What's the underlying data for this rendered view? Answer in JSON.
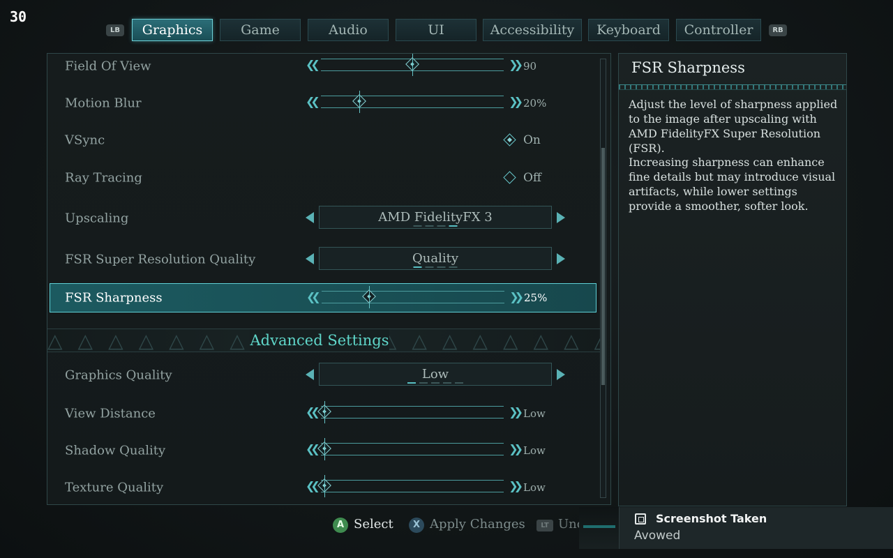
{
  "fps_counter": "30",
  "tabs": {
    "left_bumper": "LB",
    "right_bumper": "RB",
    "items": [
      {
        "label": "Graphics",
        "active": true
      },
      {
        "label": "Game"
      },
      {
        "label": "Audio"
      },
      {
        "label": "UI"
      },
      {
        "label": "Accessibility"
      },
      {
        "label": "Keyboard"
      },
      {
        "label": "Controller"
      }
    ]
  },
  "settings": {
    "field_of_view": {
      "label": "Field Of View",
      "value": "90",
      "level": 0.5
    },
    "motion_blur": {
      "label": "Motion Blur",
      "value": "20%",
      "level": 0.2
    },
    "vsync": {
      "label": "VSync",
      "value": "On",
      "enabled": true
    },
    "ray_tracing": {
      "label": "Ray Tracing",
      "value": "Off",
      "enabled": false
    },
    "upscaling": {
      "label": "Upscaling",
      "value": "AMD FidelityFX 3",
      "option_index": 3,
      "option_count": 4
    },
    "fsr_quality": {
      "label": "FSR Super Resolution Quality",
      "value": "Quality",
      "option_index": 1,
      "option_count": 4
    },
    "fsr_sharpness": {
      "label": "FSR Sharpness",
      "value": "25%",
      "level": 0.25,
      "selected": true
    }
  },
  "advanced": {
    "title": "Advanced Settings",
    "graphics_quality": {
      "label": "Graphics Quality",
      "value": "Low",
      "option_index": 1,
      "option_count": 5
    },
    "view_distance": {
      "label": "View Distance",
      "value": "Low",
      "level": 0
    },
    "shadow_quality": {
      "label": "Shadow Quality",
      "value": "Low",
      "level": 0
    },
    "texture_quality": {
      "label": "Texture Quality",
      "value": "Low",
      "level": 0
    }
  },
  "description": {
    "title": "FSR Sharpness",
    "paragraph1": "Adjust the level of sharpness applied to the image after upscaling with AMD FidelityFX Super Resolution (FSR).",
    "paragraph2": "Increasing sharpness can enhance fine details but may introduce visual artifacts, while lower settings provide a smoother, softer look."
  },
  "footer": {
    "a_button": "A",
    "select_label": "Select",
    "x_button": "X",
    "apply_label": "Apply Changes",
    "lt_button": "LT",
    "undo_label": "Unc"
  },
  "toast": {
    "title": "Screenshot Taken",
    "subtitle": "Avowed"
  },
  "colors": {
    "accent": "#5fd0d6",
    "section_title": "#5fd6c9",
    "selected_row_bg": "#1c5a60"
  }
}
